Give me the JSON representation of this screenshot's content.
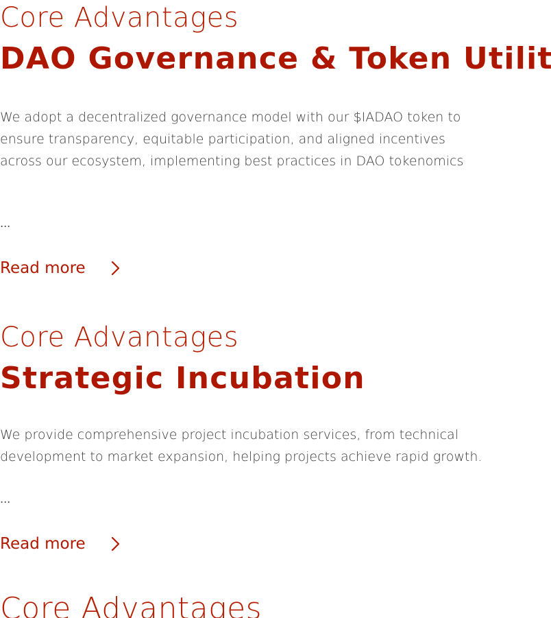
{
  "sections": [
    {
      "eyebrow": "Core Advantages",
      "title": "DAO Governance & Token Utility",
      "description_lines": [
        "We adopt a decentralized governance model with our $IADAO token to",
        "ensure transparency, equitable participation, and aligned incentives",
        "across our ecosystem, implementing best practices in DAO tokenomics"
      ],
      "ellipsis": "...",
      "read_more": "Read more"
    },
    {
      "eyebrow": "Core Advantages",
      "title": "Strategic Incubation",
      "description_lines": [
        "We provide comprehensive project incubation services, from technical",
        "development to market expansion, helping projects achieve rapid growth."
      ],
      "ellipsis": "...",
      "read_more": "Read more"
    },
    {
      "eyebrow": "Core Advantages"
    }
  ],
  "icons": {
    "read_more_icon": "chevron-right-icon"
  },
  "colors": {
    "accent": "#b01a00",
    "body_text": "#3a3a3a"
  }
}
